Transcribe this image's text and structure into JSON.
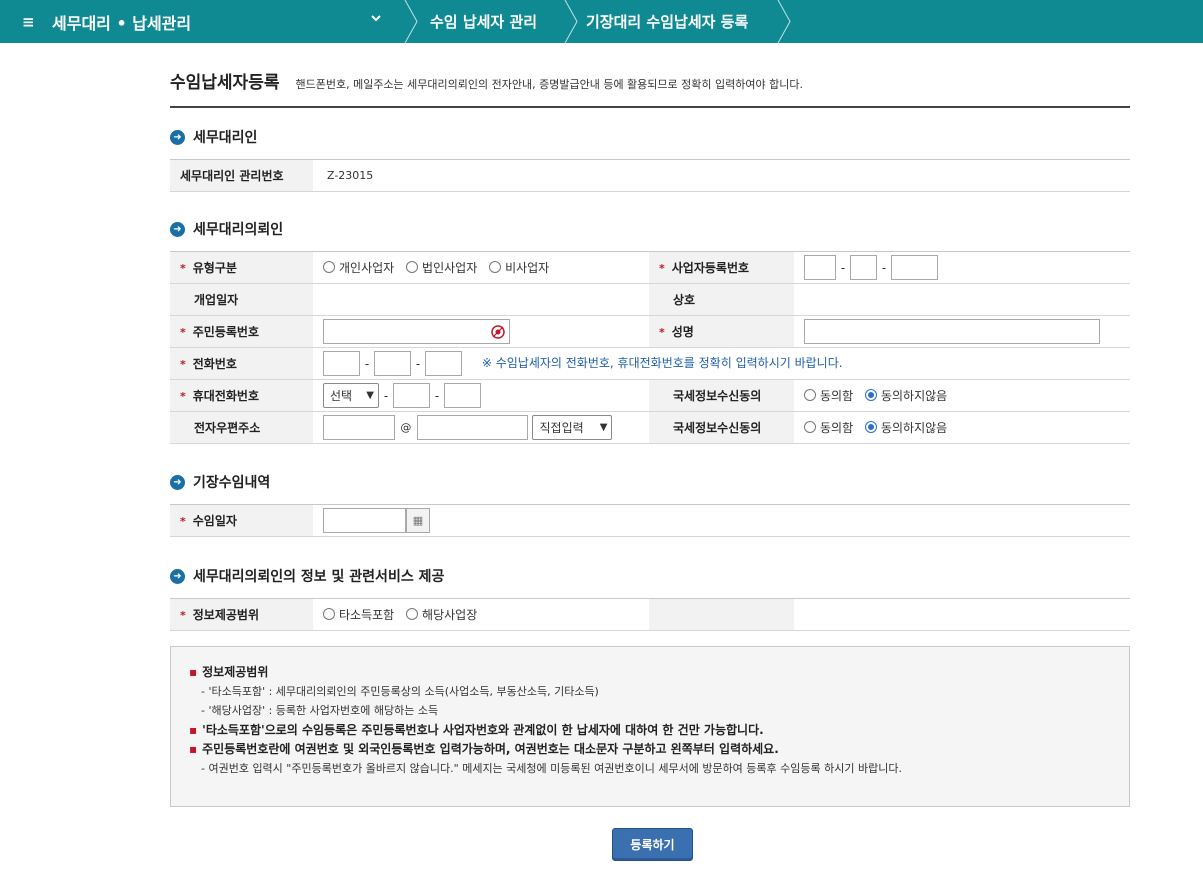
{
  "nav": {
    "menu_label": "세무대리 • 납세관리",
    "hamburger_glyph": "≡",
    "chevron_glyph": "⌄",
    "crumbs": [
      "수임 납세자 관리",
      "기장대리 수임납세자 등록"
    ],
    "bar_color": "#0f8a93"
  },
  "page": {
    "title": "수임납세자등록",
    "desc": "핸드폰번호, 메일주소는 세무대리의뢰인의 전자안내, 증명발급안내 등에 활용되므로 정확히 입력하여야 합니다."
  },
  "sec_agent": {
    "title": "세무대리인",
    "mgmt_label": "세무대리인 관리번호",
    "mgmt_value": "Z-23015"
  },
  "sec_client": {
    "title": "세무대리의뢰인",
    "type_label": "유형구분",
    "type_options": [
      "개인사업자",
      "법인사업자",
      "비사업자"
    ],
    "bizno_label": "사업자등록번호",
    "open_date_label": "개업일자",
    "company_label": "상호",
    "rrn_label": "주민등록번호",
    "name_label": "성명",
    "phone_label": "전화번호",
    "phone_hint": "※ 수임납세자의 전화번호, 휴대전화번호를 정확히 입력하시기 바랍니다.",
    "mobile_label": "휴대전화번호",
    "mobile_select": "선택",
    "consent1_label": "국세정보수신동의",
    "email_label": "전자우편주소",
    "email_at": "@",
    "email_select": "직접입력",
    "consent2_label": "국세정보수신동의",
    "consent_agree": "동의함",
    "consent_disagree": "동의하지않음"
  },
  "sec_contract": {
    "title": "기장수임내역",
    "date_label": "수임일자"
  },
  "sec_info": {
    "title": "세무대리의뢰인의 정보 및 관련서비스 제공",
    "scope_label": "정보제공범위",
    "scope_options": [
      "타소득포함",
      "해당사업장"
    ]
  },
  "notice": {
    "l1": "정보제공범위",
    "l2": "- '타소득포함' : 세무대리의뢰인의 주민등록상의 소득(사업소득, 부동산소득, 기타소득)",
    "l3": "- '해당사업장' : 등록한 사업자번호에 해당하는 소득",
    "l4": "'타소득포함'으로의 수임등록은 주민등록번호나 사업자번호와 관계없이 한 납세자에 대하여 한 건만 가능합니다.",
    "l5": "주민등록번호란에 여권번호 및 외국인등록번호 입력가능하며, 여권번호는 대소문자 구분하고 왼쪽부터 입력하세요.",
    "l6": "- 여권번호 입력시 \"주민등록번호가 올바르지 않습니다.\" 메세지는 국세청에 미등록된 여권번호이니 세무서에 방문하여 등록후 수임등록 하시기 바랍니다.",
    "bullet": "▪"
  },
  "submit_label": "등록하기",
  "colors": {
    "accent": "#1a6fa6",
    "required": "#c0182b",
    "hint": "#1f5fa8",
    "button": "#3a6fb0"
  }
}
